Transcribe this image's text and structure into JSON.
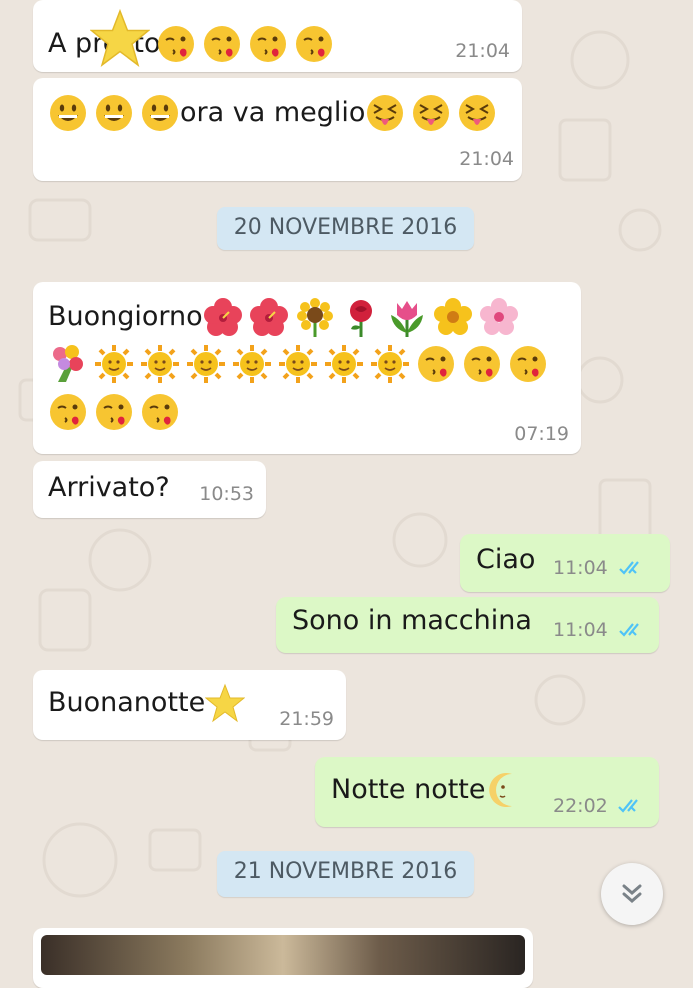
{
  "chat": {
    "messages": [
      {
        "from": "in",
        "text": "A presto ",
        "emojis_after": [
          "star",
          "kiss",
          "kiss",
          "kiss",
          "kiss"
        ],
        "time": "21:04"
      },
      {
        "from": "in",
        "emojis_before": [
          "grin",
          "grin",
          "grin"
        ],
        "text": "ora va meglio",
        "emojis_after": [
          "tongue",
          "tongue",
          "tongue"
        ],
        "time": "21:04"
      },
      {
        "from": "in",
        "text": "Buongiorno",
        "time": "07:19",
        "line1_emojis": [
          "hibiscus",
          "hibiscus",
          "sunflower",
          "rose",
          "tulip",
          "blossom",
          "cherry-blossom"
        ],
        "line2_emojis": [
          "bouquet",
          "sun-face",
          "sun-face",
          "sun-face",
          "sun-face",
          "sun-face",
          "sun-face",
          "sun-face",
          "kiss",
          "kiss",
          "kiss"
        ],
        "line3_emojis": [
          "kiss",
          "kiss",
          "kiss"
        ]
      },
      {
        "from": "in",
        "text": "Arrivato?",
        "time": "10:53"
      },
      {
        "from": "out",
        "text": "Ciao",
        "time": "11:04",
        "status": "read"
      },
      {
        "from": "out",
        "text": "Sono in macchina",
        "time": "11:04",
        "status": "read"
      },
      {
        "from": "in",
        "text": "Buonanotte",
        "emojis_after": [
          "star"
        ],
        "time": "21:59"
      },
      {
        "from": "out",
        "text": "Notte notte ",
        "emojis_after": [
          "crescent-moon-face"
        ],
        "time": "22:02",
        "status": "read"
      }
    ],
    "dates": [
      "20 NOVEMBRE 2016",
      "21 NOVEMBRE 2016"
    ],
    "scroll_button_icon": "double-chevron-down-icon"
  },
  "colors": {
    "background": "#ece5dd",
    "incoming_bubble": "#ffffff",
    "outgoing_bubble": "#dcf8c6",
    "read_ticks": "#4fc3f7",
    "date_chip": "#d4e7f3"
  }
}
